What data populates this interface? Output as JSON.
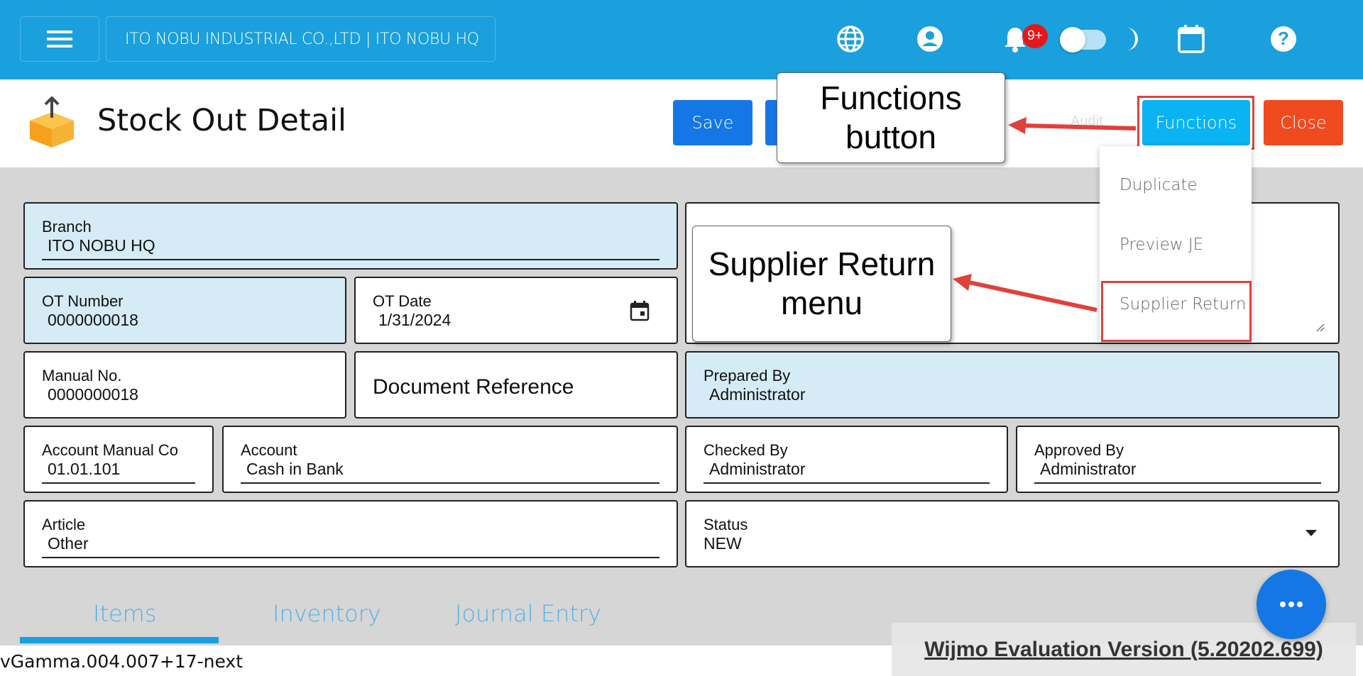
{
  "topbar": {
    "company": "ITO NOBU INDUSTRIAL CO.,LTD | ITO NOBU HQ",
    "notification_count": "9+",
    "icons": [
      "menu-icon",
      "globe-icon",
      "account-icon",
      "bell-icon",
      "moon-icon",
      "calendar-icon",
      "help-icon"
    ]
  },
  "header": {
    "title": "Stock Out Detail",
    "save_label": "Save",
    "audit_label": "Audit",
    "functions_label": "Functions",
    "close_label": "Close"
  },
  "functions_menu": {
    "items": [
      "Duplicate",
      "Preview JE",
      "Supplier Return"
    ]
  },
  "callouts": {
    "functions": "Functions button",
    "supplier": "Supplier Return menu"
  },
  "form": {
    "branch": {
      "label": "Branch",
      "value": "ITO NOBU HQ"
    },
    "ot_number": {
      "label": "OT Number",
      "value": "0000000018"
    },
    "ot_date": {
      "label": "OT Date",
      "value": "1/31/2024"
    },
    "manual_no": {
      "label": "Manual No.",
      "value": "0000000018"
    },
    "document_reference": {
      "placeholder": "Document Reference"
    },
    "prepared_by": {
      "label": "Prepared By",
      "value": "Administrator"
    },
    "account_manual_code": {
      "label": "Account Manual Co",
      "value": "01.01.101"
    },
    "account": {
      "label": "Account",
      "value": "Cash in Bank"
    },
    "checked_by": {
      "label": "Checked By",
      "value": "Administrator"
    },
    "approved_by": {
      "label": "Approved By",
      "value": "Administrator"
    },
    "article": {
      "label": "Article",
      "value": "Other"
    },
    "status": {
      "label": "Status",
      "value": "NEW"
    }
  },
  "tabs": [
    "Items",
    "Inventory",
    "Journal Entry"
  ],
  "footer": {
    "version": "vGamma.004.007+17-next",
    "wijmo": "Wijmo Evaluation Version (5.20202.699)"
  },
  "colors": {
    "topbar": "#1aa0dc",
    "save": "#1477e5",
    "functions": "#0ab3f2",
    "close": "#f04a1f",
    "highlight": "#e0413b"
  }
}
